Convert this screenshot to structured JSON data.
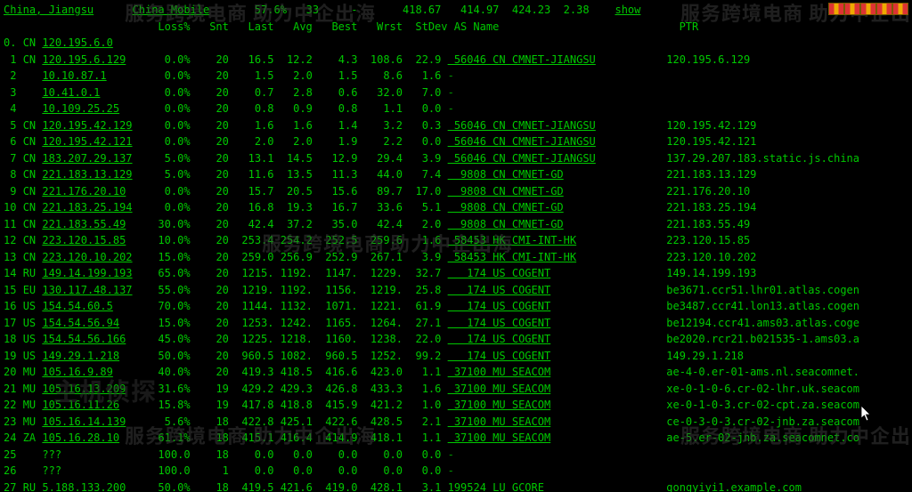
{
  "header": {
    "location": "China, Jiangsu",
    "isp": "China Mobile",
    "pct": "57.6%",
    "ttl": "33",
    "dash": "-",
    "last": "418.67",
    "avg": "414.97",
    "best": "424.23",
    "stdev": "2.38",
    "action": "show"
  },
  "columns": {
    "loss": "Loss%",
    "snt": "Snt",
    "last": "Last",
    "avg": "Avg",
    "best": "Best",
    "wrst": "Wrst",
    "stdev": "StDev",
    "asname": "AS Name",
    "ptr": "PTR"
  },
  "watermark_left": "服务跨境电商 助力中企出海",
  "watermark_right": "服务跨境电商 助力中企出",
  "rows": [
    {
      "n": "0.",
      "cc": "CN",
      "ip": "120.195.6.0",
      "loss": "",
      "snt": "",
      "last": "",
      "avg": "",
      "best": "",
      "wrst": "",
      "stdev": "",
      "asn": "",
      "org": "",
      "ptr": ""
    },
    {
      "n": "1",
      "cc": "CN",
      "ip": "120.195.6.129",
      "loss": "0.0%",
      "snt": "20",
      "last": "16.5",
      "avg": "12.2",
      "best": "4.3",
      "wrst": "108.6",
      "stdev": "22.9",
      "asn": "56046",
      "asncc": "CN",
      "org": "CMNET-JIANGSU",
      "ptr": "120.195.6.129"
    },
    {
      "n": "2",
      "cc": "",
      "ip": "10.10.87.1",
      "loss": "0.0%",
      "snt": "20",
      "last": "1.5",
      "avg": "2.0",
      "best": "1.5",
      "wrst": "8.6",
      "stdev": "1.6",
      "asn": "",
      "org": "-",
      "ptr": ""
    },
    {
      "n": "3",
      "cc": "",
      "ip": "10.41.0.1",
      "loss": "0.0%",
      "snt": "20",
      "last": "0.7",
      "avg": "2.8",
      "best": "0.6",
      "wrst": "32.0",
      "stdev": "7.0",
      "asn": "",
      "org": "-",
      "ptr": ""
    },
    {
      "n": "4",
      "cc": "",
      "ip": "10.109.25.25",
      "loss": "0.0%",
      "snt": "20",
      "last": "0.8",
      "avg": "0.9",
      "best": "0.8",
      "wrst": "1.1",
      "stdev": "0.0",
      "asn": "",
      "org": "-",
      "ptr": ""
    },
    {
      "n": "5",
      "cc": "CN",
      "ip": "120.195.42.129",
      "loss": "0.0%",
      "snt": "20",
      "last": "1.6",
      "avg": "1.6",
      "best": "1.4",
      "wrst": "3.2",
      "stdev": "0.3",
      "asn": "56046",
      "asncc": "CN",
      "org": "CMNET-JIANGSU",
      "ptr": "120.195.42.129"
    },
    {
      "n": "6",
      "cc": "CN",
      "ip": "120.195.42.121",
      "loss": "0.0%",
      "snt": "20",
      "last": "2.0",
      "avg": "2.0",
      "best": "1.9",
      "wrst": "2.2",
      "stdev": "0.0",
      "asn": "56046",
      "asncc": "CN",
      "org": "CMNET-JIANGSU",
      "ptr": "120.195.42.121"
    },
    {
      "n": "7",
      "cc": "CN",
      "ip": "183.207.29.137",
      "loss": "5.0%",
      "snt": "20",
      "last": "13.1",
      "avg": "14.5",
      "best": "12.9",
      "wrst": "29.4",
      "stdev": "3.9",
      "asn": "56046",
      "asncc": "CN",
      "org": "CMNET-JIANGSU",
      "ptr": "137.29.207.183.static.js.china"
    },
    {
      "n": "8",
      "cc": "CN",
      "ip": "221.183.13.129",
      "loss": "5.0%",
      "snt": "20",
      "last": "11.6",
      "avg": "13.5",
      "best": "11.3",
      "wrst": "44.0",
      "stdev": "7.4",
      "asn": "9808",
      "asncc": "CN",
      "org": "CMNET-GD",
      "ptr": "221.183.13.129"
    },
    {
      "n": "9",
      "cc": "CN",
      "ip": "221.176.20.10",
      "loss": "0.0%",
      "snt": "20",
      "last": "15.7",
      "avg": "20.5",
      "best": "15.6",
      "wrst": "89.7",
      "stdev": "17.0",
      "asn": "9808",
      "asncc": "CN",
      "org": "CMNET-GD",
      "ptr": "221.176.20.10"
    },
    {
      "n": "10",
      "cc": "CN",
      "ip": "221.183.25.194",
      "loss": "0.0%",
      "snt": "20",
      "last": "16.8",
      "avg": "19.3",
      "best": "16.7",
      "wrst": "33.6",
      "stdev": "5.1",
      "asn": "9808",
      "asncc": "CN",
      "org": "CMNET-GD",
      "ptr": "221.183.25.194"
    },
    {
      "n": "11",
      "cc": "CN",
      "ip": "221.183.55.49",
      "loss": "30.0%",
      "snt": "20",
      "last": "42.4",
      "avg": "37.2",
      "best": "35.0",
      "wrst": "42.4",
      "stdev": "2.0",
      "asn": "9808",
      "asncc": "CN",
      "org": "CMNET-GD",
      "ptr": "221.183.55.49"
    },
    {
      "n": "12",
      "cc": "CN",
      "ip": "223.120.15.85",
      "loss": "10.0%",
      "snt": "20",
      "last": "253.4",
      "avg": "254.2",
      "best": "252.5",
      "wrst": "259.6",
      "stdev": "1.6",
      "asn": "58453",
      "asncc": "HK",
      "org": "CMI-INT-HK",
      "ptr": "223.120.15.85"
    },
    {
      "n": "13",
      "cc": "CN",
      "ip": "223.120.10.202",
      "loss": "15.0%",
      "snt": "20",
      "last": "259.0",
      "avg": "256.9",
      "best": "252.9",
      "wrst": "267.1",
      "stdev": "3.9",
      "asn": "58453",
      "asncc": "HK",
      "org": "CMI-INT-HK",
      "ptr": "223.120.10.202"
    },
    {
      "n": "14",
      "cc": "RU",
      "ip": "149.14.199.193",
      "loss": "65.0%",
      "snt": "20",
      "last": "1215.",
      "avg": "1192.",
      "best": "1147.",
      "wrst": "1229.",
      "stdev": "32.7",
      "asn": "174",
      "asncc": "US",
      "org": "COGENT",
      "ptr": "149.14.199.193"
    },
    {
      "n": "15",
      "cc": "EU",
      "ip": "130.117.48.137",
      "loss": "55.0%",
      "snt": "20",
      "last": "1219.",
      "avg": "1192.",
      "best": "1156.",
      "wrst": "1219.",
      "stdev": "25.8",
      "asn": "174",
      "asncc": "US",
      "org": "COGENT",
      "ptr": "be3671.ccr51.lhr01.atlas.cogen"
    },
    {
      "n": "16",
      "cc": "US",
      "ip": "154.54.60.5",
      "loss": "70.0%",
      "snt": "20",
      "last": "1144.",
      "avg": "1132.",
      "best": "1071.",
      "wrst": "1221.",
      "stdev": "61.9",
      "asn": "174",
      "asncc": "US",
      "org": "COGENT",
      "ptr": "be3487.ccr41.lon13.atlas.cogen"
    },
    {
      "n": "17",
      "cc": "US",
      "ip": "154.54.56.94",
      "loss": "15.0%",
      "snt": "20",
      "last": "1253.",
      "avg": "1242.",
      "best": "1165.",
      "wrst": "1264.",
      "stdev": "27.1",
      "asn": "174",
      "asncc": "US",
      "org": "COGENT",
      "ptr": "be12194.ccr41.ams03.atlas.coge"
    },
    {
      "n": "18",
      "cc": "US",
      "ip": "154.54.56.166",
      "loss": "45.0%",
      "snt": "20",
      "last": "1225.",
      "avg": "1218.",
      "best": "1160.",
      "wrst": "1238.",
      "stdev": "22.0",
      "asn": "174",
      "asncc": "US",
      "org": "COGENT",
      "ptr": "be2020.rcr21.b021535-1.ams03.a"
    },
    {
      "n": "19",
      "cc": "US",
      "ip": "149.29.1.218",
      "loss": "50.0%",
      "snt": "20",
      "last": "960.5",
      "avg": "1082.",
      "best": "960.5",
      "wrst": "1252.",
      "stdev": "99.2",
      "asn": "174",
      "asncc": "US",
      "org": "COGENT",
      "ptr": "149.29.1.218"
    },
    {
      "n": "20",
      "cc": "MU",
      "ip": "105.16.9.89",
      "loss": "40.0%",
      "snt": "20",
      "last": "419.3",
      "avg": "418.5",
      "best": "416.6",
      "wrst": "423.0",
      "stdev": "1.1",
      "asn": "37100",
      "asncc": "MU",
      "org": "SEACOM",
      "ptr": "ae-4-0.er-01-ams.nl.seacomnet."
    },
    {
      "n": "21",
      "cc": "MU",
      "ip": "105.16.13.209",
      "loss": "31.6%",
      "snt": "19",
      "last": "429.2",
      "avg": "429.3",
      "best": "426.8",
      "wrst": "433.3",
      "stdev": "1.6",
      "asn": "37100",
      "asncc": "MU",
      "org": "SEACOM",
      "ptr": "xe-0-1-0-6.cr-02-lhr.uk.seacom"
    },
    {
      "n": "22",
      "cc": "MU",
      "ip": "105.16.11.26",
      "loss": "15.8%",
      "snt": "19",
      "last": "417.8",
      "avg": "418.8",
      "best": "415.9",
      "wrst": "421.2",
      "stdev": "1.0",
      "asn": "37100",
      "asncc": "MU",
      "org": "SEACOM",
      "ptr": "xe-0-1-0-3.cr-02-cpt.za.seacom"
    },
    {
      "n": "23",
      "cc": "MU",
      "ip": "105.16.14.139",
      "loss": "5.6%",
      "snt": "18",
      "last": "422.8",
      "avg": "425.1",
      "best": "422.6",
      "wrst": "428.5",
      "stdev": "2.1",
      "asn": "37100",
      "asncc": "MU",
      "org": "SEACOM",
      "ptr": "ce-0-3-0-3.cr-02-jnb.za.seacom"
    },
    {
      "n": "24",
      "cc": "ZA",
      "ip": "105.16.28.10",
      "loss": "61.1%",
      "snt": "18",
      "last": "415.1",
      "avg": "416.4",
      "best": "414.9",
      "wrst": "418.1",
      "stdev": "1.1",
      "asn": "37100",
      "asncc": "MU",
      "org": "SEACOM",
      "ptr": "ae-5.er-02-jnb.za.seacomnet.co"
    },
    {
      "n": "25",
      "cc": "",
      "ip": "???",
      "loss": "100.0",
      "snt": "18",
      "last": "0.0",
      "avg": "0.0",
      "best": "0.0",
      "wrst": "0.0",
      "stdev": "0.0",
      "asn": "",
      "org": "-",
      "ptr": ""
    },
    {
      "n": "26",
      "cc": "",
      "ip": "???",
      "loss": "100.0",
      "snt": "1",
      "last": "0.0",
      "avg": "0.0",
      "best": "0.0",
      "wrst": "0.0",
      "stdev": "0.0",
      "asn": "",
      "org": "-",
      "ptr": ""
    },
    {
      "n": "27",
      "cc": "RU",
      "ip": "5.188.133.200",
      "loss": "50.0%",
      "snt": "18",
      "last": "419.5",
      "avg": "421.6",
      "best": "419.0",
      "wrst": "428.1",
      "stdev": "3.1",
      "asn": "199524",
      "asncc": "LU",
      "org": "GCORE",
      "ptr": "gongyiyi1.example.com"
    }
  ]
}
